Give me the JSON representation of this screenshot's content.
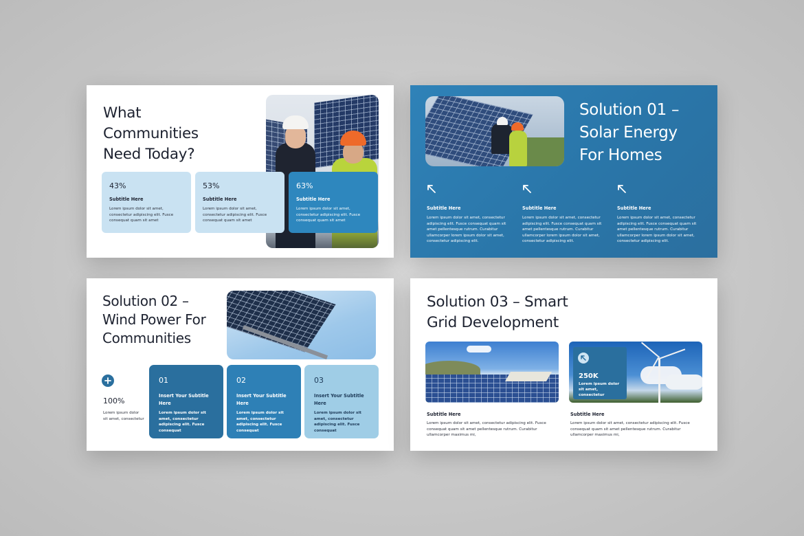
{
  "colors": {
    "primary": "#2e87be",
    "dark_blue": "#2a6f9e",
    "light_blue": "#c9e2f2",
    "pale_blue": "#9fcde6",
    "text": "#1d2230"
  },
  "icons": {
    "arrow": "arrow-up-left-icon",
    "plus": "plus-icon"
  },
  "slide1": {
    "title_lines": [
      "What",
      "Communities",
      "Need Today?"
    ],
    "cards": [
      {
        "percent": "43%",
        "subtitle": "Subtitle Here",
        "text": "Lorem ipsum dolor sit amet, consectetur adipiscing elit. Fusce consequat quam sit amet"
      },
      {
        "percent": "53%",
        "subtitle": "Subtitle Here",
        "text": "Lorem ipsum dolor sit amet, consectetur adipiscing elit. Fusce consequat quam sit amet"
      },
      {
        "percent": "63%",
        "subtitle": "Subtitle Here",
        "text": "Lorem ipsum dolor sit amet, consectetur adipiscing elit. Fusce consequat quam sit amet"
      }
    ]
  },
  "slide2": {
    "title_lines": [
      "Solution 01 –",
      "Solar Energy",
      "For Homes"
    ],
    "columns": [
      {
        "subtitle": "Subtitle Here",
        "text": "Lorem ipsum dolor sit amet, consectetur adipiscing elit. Fusce consequat quam sit amet pellentesque rutrum. Curabitur ullamcorper lorem ipsum dolor sit amet, consectetur adipiscing elit."
      },
      {
        "subtitle": "Subtitle Here",
        "text": "Lorem ipsum dolor sit amet, consectetur adipiscing elit. Fusce consequat quam sit amet pellentesque rutrum. Curabitur ullamcorper lorem ipsum dolor sit amet, consectetur adipiscing elit."
      },
      {
        "subtitle": "Subtitle Here",
        "text": "Lorem ipsum dolor sit amet, consectetur adipiscing elit. Fusce consequat quam sit amet pellentesque rutrum. Curabitur ullamcorper lorem ipsum dolor sit amet, consectetur adipiscing elit."
      }
    ]
  },
  "slide3": {
    "title_lines": [
      "Solution 02 –",
      "Wind Power For",
      "Communities"
    ],
    "stat": {
      "value": "100%",
      "text": "Lorem ipsum dolor sit amet, consectetur"
    },
    "cards": [
      {
        "number": "01",
        "subtitle": "Insert Your Subtitle Here",
        "text": "Lorem ipsum dolor sit amet, consectetur adipiscing elit. Fusce consequat"
      },
      {
        "number": "02",
        "subtitle": "Insert Your Subtitle Here",
        "text": "Lorem ipsum dolor sit amet, consectetur adipiscing elit. Fusce consequat"
      },
      {
        "number": "03",
        "subtitle": "Insert Your Subtitle Here",
        "text": "Lorem ipsum dolor sit amet, consectetur adipiscing elit. Fusce consequat"
      }
    ]
  },
  "slide4": {
    "title_lines": [
      "Solution 03 – Smart",
      "Grid Development"
    ],
    "stat": {
      "value": "250K",
      "text": "Lorem ipsum dolor sit amet, consectetur"
    },
    "columns": [
      {
        "subtitle": "Subtitle Here",
        "text": "Lorem ipsum dolor sit amet, consectetur adipiscing elit. Fusce consequat quam sit amet pellentesque rutrum. Curabitur ullamcorper maximus mi,"
      },
      {
        "subtitle": "Subtitle Here",
        "text": "Lorem ipsum dolor sit amet, consectetur adipiscing elit. Fusce consequat quam sit amet pellentesque rutrum. Curabitur ullamcorper maximus mi,"
      }
    ]
  }
}
